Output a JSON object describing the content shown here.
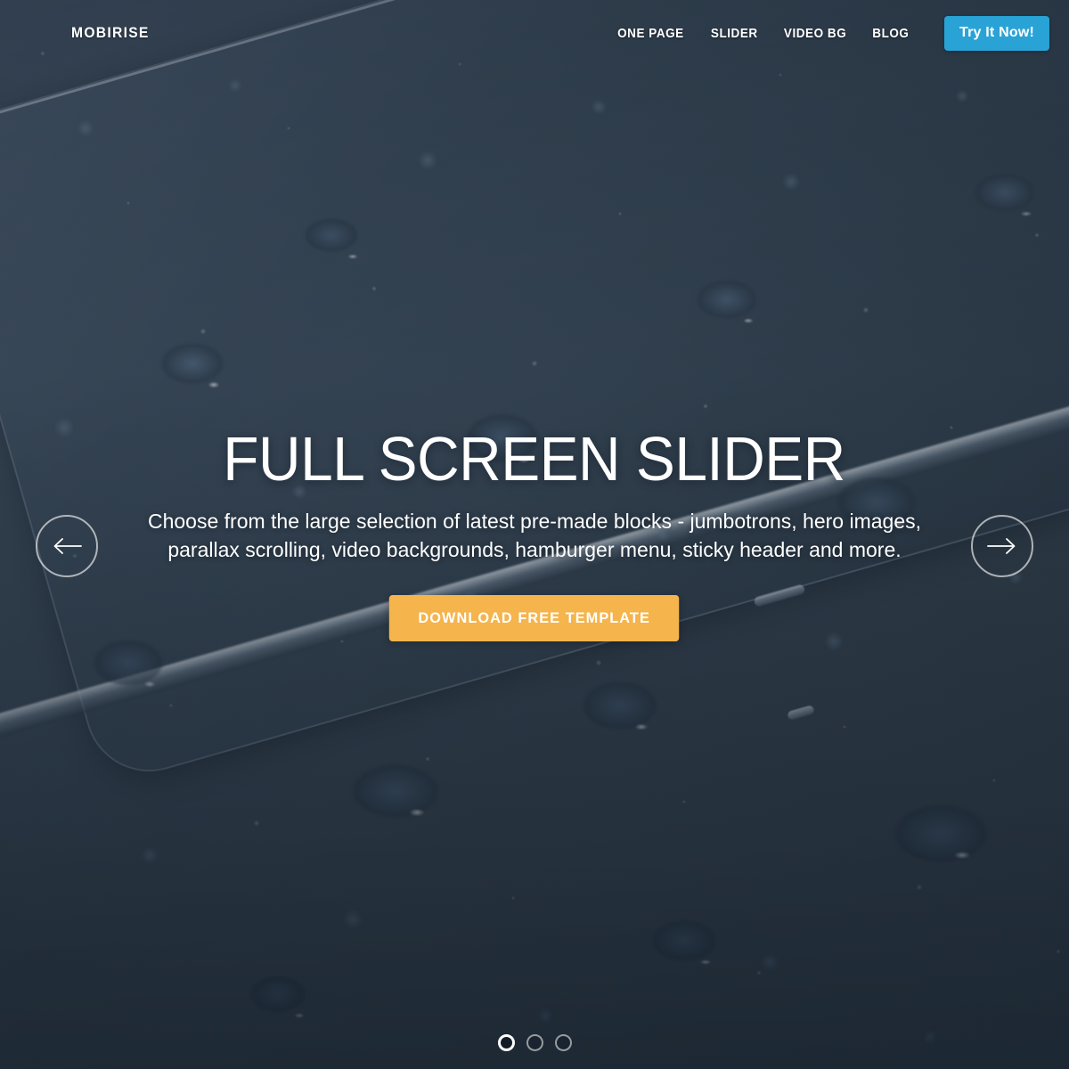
{
  "header": {
    "brand": "MOBIRISE",
    "nav_items": [
      {
        "label": "ONE PAGE"
      },
      {
        "label": "SLIDER"
      },
      {
        "label": "VIDEO BG"
      },
      {
        "label": "BLOG"
      }
    ],
    "cta_label": "Try It Now!",
    "cta_color": "#29a3d6"
  },
  "slide": {
    "title": "FULL SCREEN SLIDER",
    "subtitle": "Choose from the large selection of latest pre-made blocks - jumbotrons, hero images, parallax scrolling, video backgrounds, hamburger menu, sticky header and more.",
    "button_label": "Download Free Template",
    "button_color": "#f5b44c",
    "prev_icon": "arrow-left-icon",
    "next_icon": "arrow-right-icon"
  },
  "indicators": {
    "count": 3,
    "active_index": 0
  }
}
